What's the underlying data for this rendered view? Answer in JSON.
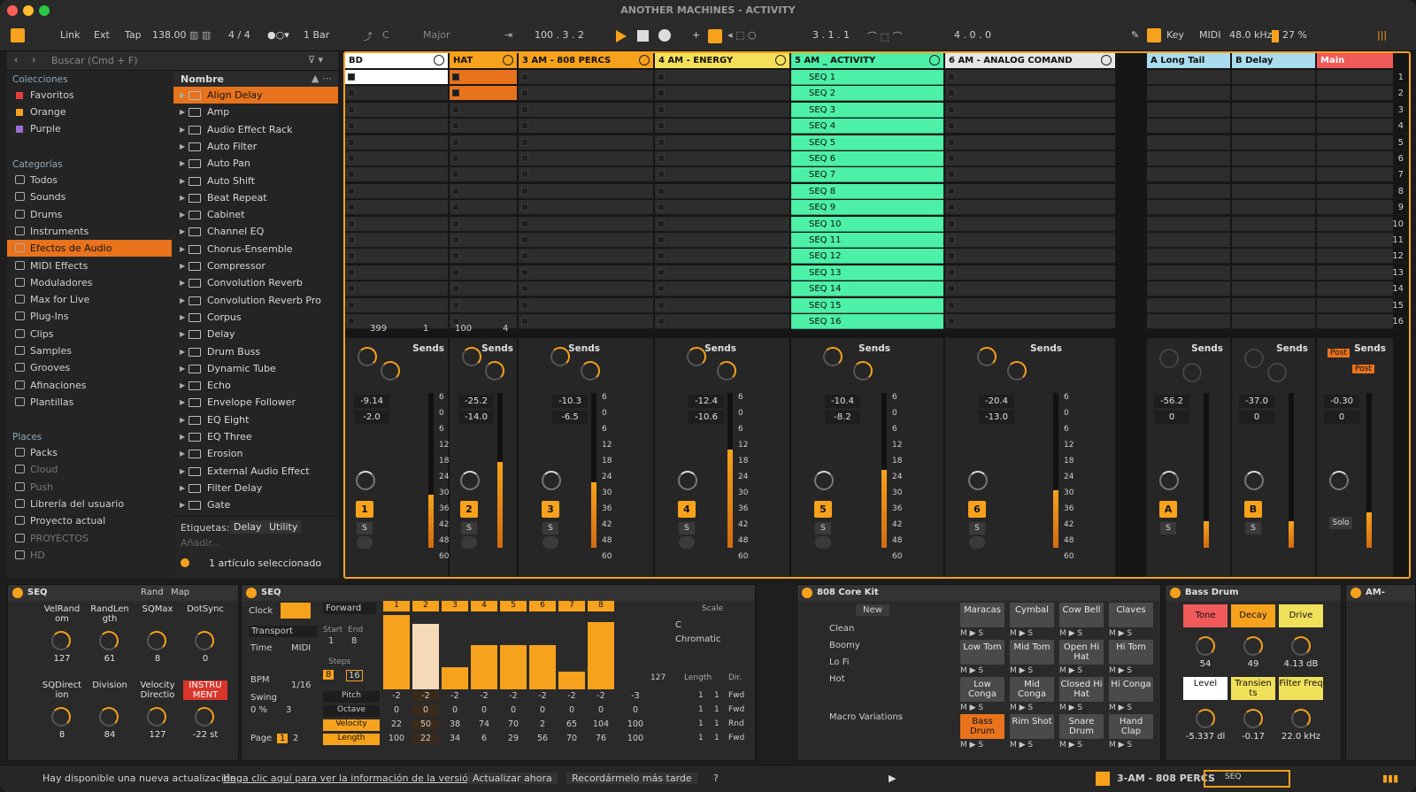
{
  "window": {
    "title": "ANOTHER MACHINES - ACTIVITY"
  },
  "toolbar": {
    "link": "Link",
    "ext": "Ext",
    "tap": "Tap",
    "tempo": "138.00",
    "signature": "4 / 4",
    "quantize": "1 Bar",
    "key_root": "C",
    "key_scale": "Major",
    "position": "100 .  3 .  2",
    "loop_start": "3 .  1 .  1",
    "loop_length": "4 .  0 .  0",
    "key_label": "Key",
    "midi_label": "MIDI",
    "sample_rate": "48.0 kHz",
    "cpu": "27 %"
  },
  "browser": {
    "search_placeholder": "Buscar (Cmd + F)",
    "collections_title": "Colecciones",
    "collections": [
      {
        "label": "Favoritos",
        "color": "#e23b3b"
      },
      {
        "label": "Orange",
        "color": "#f7a21c"
      },
      {
        "label": "Purple",
        "color": "#9b6bd6"
      }
    ],
    "categories_title": "Categorías",
    "categories": [
      "Todos",
      "Sounds",
      "Drums",
      "Instruments",
      "Efectos de Audio",
      "MIDI Effects",
      "Moduladores",
      "Max for Live",
      "Plug-Ins",
      "Clips",
      "Samples",
      "Grooves",
      "Afinaciones",
      "Plantillas"
    ],
    "selected_category": "Efectos de Audio",
    "places_title": "Places",
    "places": [
      "Packs",
      "Cloud",
      "Push",
      "Librería del usuario",
      "Proyecto actual",
      "PROYECTOS",
      "HD"
    ],
    "list_header": "Nombre",
    "items": [
      "Align Delay",
      "Amp",
      "Audio Effect Rack",
      "Auto Filter",
      "Auto Pan",
      "Auto Shift",
      "Beat Repeat",
      "Cabinet",
      "Channel EQ",
      "Chorus-Ensemble",
      "Compressor",
      "Convolution Reverb",
      "Convolution Reverb Pro",
      "Corpus",
      "Delay",
      "Drum Buss",
      "Dynamic Tube",
      "Echo",
      "Envelope Follower",
      "EQ Eight",
      "EQ Three",
      "Erosion",
      "External Audio Effect",
      "Filter Delay",
      "Gate"
    ],
    "selected_item": "Align Delay",
    "tags_label": "Etiquetas:",
    "tags": [
      "Delay",
      "Utility"
    ],
    "add_label": "Añadir...",
    "selection_info": "1 artículo seleccionado"
  },
  "tracks": [
    {
      "name": "BD",
      "color": "#ffffff",
      "num": "1",
      "vol": "-9.14",
      "pan": "-2.0"
    },
    {
      "name": "HAT",
      "color": "#f7a21c",
      "num": "2",
      "vol": "-25.2",
      "pan": "-14.0"
    },
    {
      "name": "3 AM - 808 PERCS",
      "color": "#f7a21c",
      "num": "3",
      "vol": "-10.3",
      "pan": "-6.5"
    },
    {
      "name": "4 AM - ENERGY",
      "color": "#f5e05a",
      "num": "4",
      "vol": "-12.4",
      "pan": "-10.6"
    },
    {
      "name": "5 AM _ ACTIVITY",
      "color": "#4df0a7",
      "num": "5",
      "vol": "-10.4",
      "pan": "-8.2"
    },
    {
      "name": "6 AM -  ANALOG COMAND",
      "color": "#e6e6e6",
      "num": "6",
      "vol": "-20.4",
      "pan": "-13.0"
    }
  ],
  "returns": [
    {
      "name": "A Long Tail",
      "color": "#a9dcee",
      "num": "A",
      "vol": "-56.2",
      "pan": "0"
    },
    {
      "name": "B Delay",
      "color": "#a9dcee",
      "num": "B",
      "vol": "-37.0",
      "pan": "0"
    },
    {
      "name": "Main",
      "color": "#f05a5a",
      "vol": "-0.30",
      "pan": "0"
    }
  ],
  "clips": [
    "SEQ 1",
    "SEQ 2",
    "SEQ 3",
    "SEQ 4",
    "SEQ 5",
    "SEQ 6",
    "SEQ 7",
    "SEQ 8",
    "SEQ 9",
    "SEQ 10",
    "SEQ 11",
    "SEQ 12",
    "SEQ 13",
    "SEQ 14",
    "SEQ 15",
    "SEQ 16"
  ],
  "scenes": [
    "1",
    "2",
    "3",
    "4",
    "5",
    "6",
    "7",
    "8",
    "9",
    "10",
    "11",
    "12",
    "13",
    "14",
    "15",
    "16"
  ],
  "bd_footer": {
    "a": "399",
    "b": "1"
  },
  "hat_footer": {
    "a": "100",
    "b": "4"
  },
  "mixer": {
    "sends": "Sends",
    "post": "Post",
    "solo": "Solo",
    "s": "S",
    "meter_scale": [
      "6",
      "0",
      "6",
      "12",
      "18",
      "24",
      "30",
      "36",
      "42",
      "48",
      "60"
    ]
  },
  "seq_rack": {
    "title": "SEQ",
    "rand": "Rand",
    "map": "Map",
    "params": [
      {
        "label": "VelRand om",
        "value": "127"
      },
      {
        "label": "RandLen gth",
        "value": "61"
      },
      {
        "label": "SQMax",
        "value": "8"
      },
      {
        "label": "DotSync",
        "value": "0"
      },
      {
        "label": "SQDirect ion",
        "value": "8"
      },
      {
        "label": "Division",
        "value": "84"
      },
      {
        "label": "Velocity Directio",
        "value": "127"
      },
      {
        "label": "INSTRU MENT",
        "value": "-22 st"
      }
    ]
  },
  "seq": {
    "title": "SEQ",
    "clock": "Clock",
    "transport": "Transport",
    "time": "Time",
    "midi": "MIDI",
    "bpm": "BPM",
    "rate": "1/16",
    "swing": "Swing",
    "swing_val": "0 %",
    "swing_steps": "3",
    "page": "Page",
    "page1": "1",
    "page2": "2",
    "direction": "Forward",
    "start": "Start",
    "end": "End",
    "start_val": "1",
    "end_val": "8",
    "steps": "Steps",
    "steps8": "8",
    "steps16": "16",
    "step_nums": [
      "1",
      "2",
      "3",
      "4",
      "5",
      "6",
      "7",
      "8"
    ],
    "step_vel": [
      1.0,
      0.88,
      0.3,
      0.6,
      0.6,
      0.6,
      0.24,
      0.9
    ],
    "scale_label": "Scale",
    "scale_root": "C",
    "scale_type": "Chromatic",
    "length_label": "Length",
    "dir_label": "Dir.",
    "len_val": "127",
    "rows": [
      {
        "label": "Pitch",
        "vals": [
          "-2",
          "-2",
          "-2",
          "-2",
          "-2",
          "-2",
          "-2",
          "-2",
          "-3"
        ]
      },
      {
        "label": "Octave",
        "vals": [
          "0",
          "0",
          "0",
          "0",
          "0",
          "0",
          "0",
          "0",
          "0"
        ]
      },
      {
        "label": "Velocity",
        "vals": [
          "22",
          "50",
          "38",
          "74",
          "70",
          "2",
          "65",
          "104",
          "100"
        ]
      },
      {
        "label": "Length",
        "vals": [
          "100",
          "22",
          "34",
          "6",
          "29",
          "56",
          "70",
          "76",
          "100"
        ]
      }
    ],
    "mods": [
      {
        "a": "1",
        "b": "1",
        "dir": "Fwd"
      },
      {
        "a": "1",
        "b": "1",
        "dir": "Fwd"
      },
      {
        "a": "1",
        "b": "1",
        "dir": "Rnd"
      },
      {
        "a": "1",
        "b": "1",
        "dir": "Fwd"
      }
    ]
  },
  "kit": {
    "title": "808 Core Kit",
    "new": "New",
    "variations": [
      "Clean",
      "Boomy",
      "Lo Fi",
      "Hot"
    ],
    "macro": "Macro Variations",
    "pads": [
      "Maracas",
      "Cymbal",
      "Cow Bell",
      "Claves",
      "Low Tom",
      "Mid Tom",
      "Open Hi Hat",
      "Hi Tom",
      "Low Conga",
      "Mid Conga",
      "Closed Hi Hat",
      "Hi Conga",
      "Bass Drum",
      "Rim Shot",
      "Snare Drum",
      "Hand Clap"
    ]
  },
  "bass": {
    "title": "Bass Drum",
    "tone": "Tone",
    "decay": "Decay",
    "drive": "Drive",
    "tone_val": "54",
    "decay_val": "49",
    "drive_val": "4.13 dB",
    "level": "Level",
    "transients": "Transien ts",
    "filter": "Filter Freq",
    "level_val": "-5.337 dl",
    "trans_val": "-0.17",
    "filter_val": "22.0 kHz"
  },
  "status": {
    "msg": "Hay disponible una nueva actualización.",
    "link": "Haga clic aquí para ver la información de la versión.",
    "update": "Actualizar ahora",
    "later": "Recordármelo más tarde",
    "q": "?",
    "track": "3-AM - 808 PERCS",
    "seq": "SEQ"
  }
}
